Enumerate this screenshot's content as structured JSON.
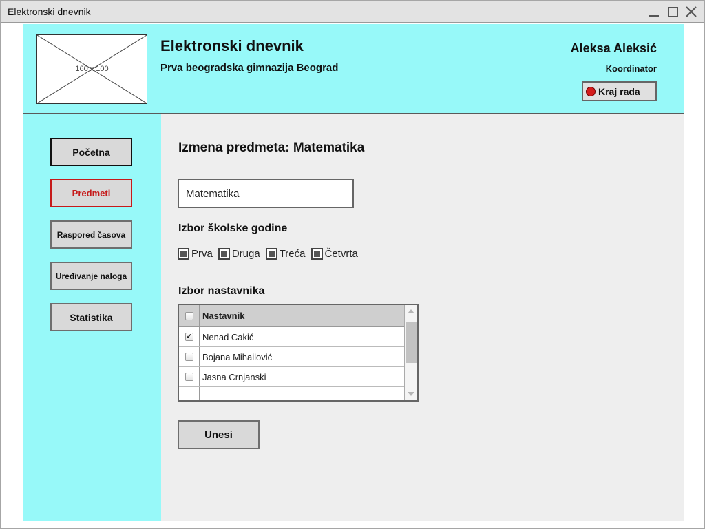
{
  "window": {
    "title": "Elektronski dnevnik"
  },
  "header": {
    "logo_placeholder": "160 x 100",
    "app_title": "Elektronski dnevnik",
    "school_name": "Prva beogradska gimnazija Beograd",
    "user_name": "Aleksa Aleksić",
    "user_role": "Koordinator",
    "logout_label": "Kraj rada",
    "logout_icon": "red-circle-icon",
    "background_color": "#97f9f9"
  },
  "sidebar": {
    "items": [
      {
        "label": "Početna",
        "active": false
      },
      {
        "label": "Predmeti",
        "active": true
      },
      {
        "label": "Raspored časova",
        "active": false
      },
      {
        "label": "Uređivanje naloga",
        "active": false
      },
      {
        "label": "Statistika",
        "active": false
      }
    ],
    "active_color": "#c61a1a"
  },
  "main": {
    "page_title": "Izmena predmeta: Matematika",
    "subject_input_value": "Matematika",
    "school_year_label": "Izbor školske godine",
    "years": [
      {
        "label": "Prva",
        "checked": true
      },
      {
        "label": "Druga",
        "checked": true
      },
      {
        "label": "Treća",
        "checked": true
      },
      {
        "label": "Četvrta",
        "checked": true
      }
    ],
    "teacher_label": "Izbor nastavnika",
    "teacher_table": {
      "header": "Nastavnik",
      "rows": [
        {
          "name": "Nenad Cakić",
          "checked": true
        },
        {
          "name": "Bojana Mihailović",
          "checked": false
        },
        {
          "name": "Jasna Crnjanski",
          "checked": false
        }
      ]
    },
    "submit_label": "Unesi"
  }
}
